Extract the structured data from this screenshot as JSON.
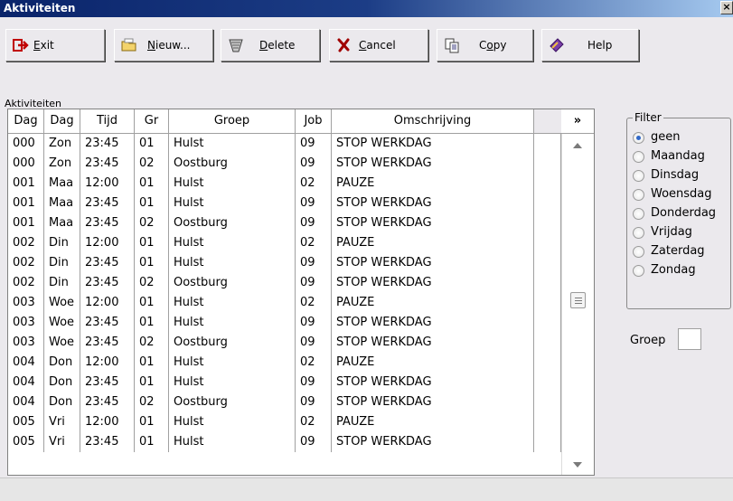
{
  "window": {
    "title": "Aktiviteiten",
    "close_glyph": "×"
  },
  "toolbar": {
    "exit": {
      "pre": "",
      "key": "E",
      "post": "xit",
      "icon": "exit-arrow-icon"
    },
    "nieuw": {
      "pre": "",
      "key": "N",
      "post": "ieuw...",
      "icon": "folder-new-icon"
    },
    "delete": {
      "pre": "",
      "key": "D",
      "post": "elete",
      "icon": "trash-icon"
    },
    "cancel": {
      "pre": "",
      "key": "C",
      "post": "ancel",
      "icon": "cancel-x-icon"
    },
    "copy": {
      "pre": "C",
      "key": "o",
      "post": "py",
      "icon": "copy-icon"
    },
    "help": {
      "pre": "",
      "key": "",
      "post": "Help",
      "icon": "help-book-icon"
    }
  },
  "section_label": "Aktiviteiten",
  "grid": {
    "headers": [
      "Dag",
      "Dag",
      "Tijd",
      "Gr",
      "Groep",
      "Job",
      "Omschrijving",
      "",
      "»"
    ],
    "rows": [
      [
        "000",
        "Zon",
        "23:45",
        "01",
        "Hulst",
        "09",
        "STOP WERKDAG"
      ],
      [
        "000",
        "Zon",
        "23:45",
        "02",
        "Oostburg",
        "09",
        "STOP WERKDAG"
      ],
      [
        "001",
        "Maa",
        "12:00",
        "01",
        "Hulst",
        "02",
        "PAUZE"
      ],
      [
        "001",
        "Maa",
        "23:45",
        "01",
        "Hulst",
        "09",
        "STOP WERKDAG"
      ],
      [
        "001",
        "Maa",
        "23:45",
        "02",
        "Oostburg",
        "09",
        "STOP WERKDAG"
      ],
      [
        "002",
        "Din",
        "12:00",
        "01",
        "Hulst",
        "02",
        "PAUZE"
      ],
      [
        "002",
        "Din",
        "23:45",
        "01",
        "Hulst",
        "09",
        "STOP WERKDAG"
      ],
      [
        "002",
        "Din",
        "23:45",
        "02",
        "Oostburg",
        "09",
        "STOP WERKDAG"
      ],
      [
        "003",
        "Woe",
        "12:00",
        "01",
        "Hulst",
        "02",
        "PAUZE"
      ],
      [
        "003",
        "Woe",
        "23:45",
        "01",
        "Hulst",
        "09",
        "STOP WERKDAG"
      ],
      [
        "003",
        "Woe",
        "23:45",
        "02",
        "Oostburg",
        "09",
        "STOP WERKDAG"
      ],
      [
        "004",
        "Don",
        "12:00",
        "01",
        "Hulst",
        "02",
        "PAUZE"
      ],
      [
        "004",
        "Don",
        "23:45",
        "01",
        "Hulst",
        "09",
        "STOP WERKDAG"
      ],
      [
        "004",
        "Don",
        "23:45",
        "02",
        "Oostburg",
        "09",
        "STOP WERKDAG"
      ],
      [
        "005",
        "Vri",
        "12:00",
        "01",
        "Hulst",
        "02",
        "PAUZE"
      ],
      [
        "005",
        "Vri",
        "23:45",
        "01",
        "Hulst",
        "09",
        "STOP WERKDAG"
      ]
    ]
  },
  "filter": {
    "legend": "Filter",
    "options": [
      "geen",
      "Maandag",
      "Dinsdag",
      "Woensdag",
      "Donderdag",
      "Vrijdag",
      "Zaterdag",
      "Zondag"
    ],
    "selected": "geen"
  },
  "groep": {
    "label": "Groep",
    "value": ""
  },
  "colors": {
    "title_bar": "#0a246a",
    "window_bg": "#ebe9ed",
    "radio_dot": "#3168c8"
  }
}
